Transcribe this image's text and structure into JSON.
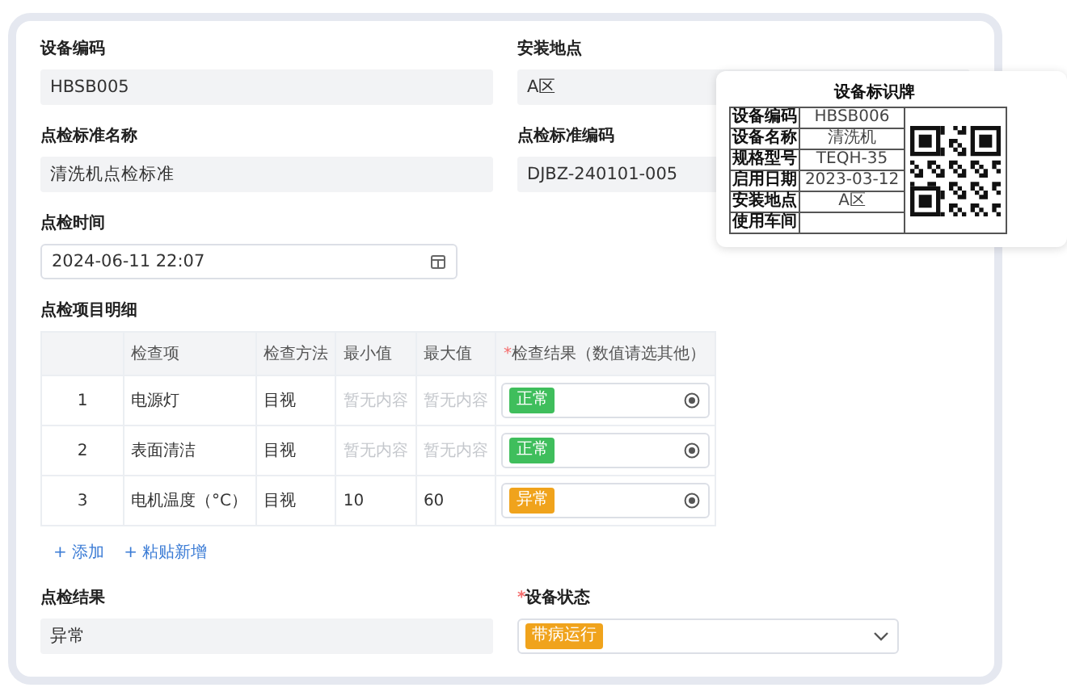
{
  "fields_top": [
    {
      "label": "设备编码",
      "value": "HBSB005"
    },
    {
      "label": "安装地点",
      "value": "A区"
    },
    {
      "label": "点检标准名称",
      "value": "清洗机点检标准"
    },
    {
      "label": "点检标准编码",
      "value": "DJBZ-240101-005"
    }
  ],
  "inspection_time": {
    "label": "点检时间",
    "value": "2024-06-11 22:07"
  },
  "detail": {
    "title": "点检项目明细",
    "columns": [
      {
        "label": "检查项"
      },
      {
        "label": "检查方法"
      },
      {
        "label": "最小值"
      },
      {
        "label": "最大值"
      },
      {
        "label": "检查结果（数值请选其他）",
        "mark": "*"
      }
    ],
    "rows": [
      {
        "index": "1",
        "item": "电源灯",
        "method": "目视",
        "min_placeholder": "暂无内容",
        "max_placeholder": "暂无内容",
        "result": "正常",
        "color": "#3fbe5c"
      },
      {
        "index": "2",
        "item": "表面清洁",
        "method": "目视",
        "min_placeholder": "暂无内容",
        "max_placeholder": "暂无内容",
        "result": "正常",
        "color": "#3fbe5c"
      },
      {
        "index": "3",
        "item": "电机温度（°C）",
        "method": "目视",
        "min": "10",
        "max": "60",
        "result": "异常",
        "color": "#f0a31c"
      }
    ],
    "actions": [
      {
        "icon": "+",
        "label": "添加"
      },
      {
        "icon": "+",
        "label": "粘贴新增"
      }
    ]
  },
  "result": {
    "label": "点检结果",
    "value": "异常"
  },
  "device_status": {
    "label": "设备状态",
    "mark": "*",
    "value": "带病运行",
    "color": "#f0a31c"
  },
  "sign_card": {
    "title": "设备标识牌",
    "rows": [
      {
        "label": "设备编码",
        "value": "HBSB006"
      },
      {
        "label": "设备名称",
        "value": "清洗机"
      },
      {
        "label": "规格型号",
        "value": "TEQH-35"
      },
      {
        "label": "启用日期",
        "value": "2023-03-12"
      },
      {
        "label": "安装地点",
        "value": "A区"
      },
      {
        "label": "使用车间"
      }
    ]
  }
}
